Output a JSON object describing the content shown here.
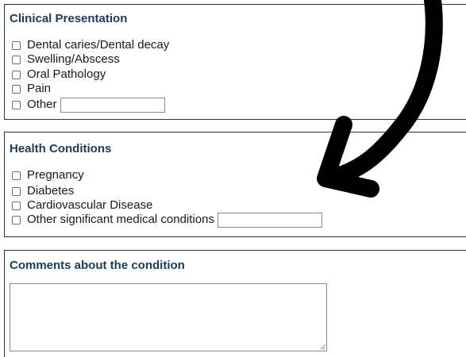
{
  "clinical": {
    "title": "Clinical Presentation",
    "options": [
      "Dental caries/Dental decay",
      "Swelling/Abscess",
      "Oral Pathology",
      "Pain",
      "Other"
    ],
    "other_value": ""
  },
  "health": {
    "title": "Health Conditions",
    "options": [
      "Pregnancy",
      "Diabetes",
      "Cardiovascular Disease",
      "Other significant medical conditions"
    ],
    "other_value": ""
  },
  "comments": {
    "title": "Comments about the condition",
    "value": ""
  },
  "colors": {
    "heading": "#1b3b5a",
    "border": "#333333",
    "arrow": "#000000"
  },
  "icons": {
    "annotation": "curved-arrow-icon",
    "resize": "resize-grip-icon"
  }
}
